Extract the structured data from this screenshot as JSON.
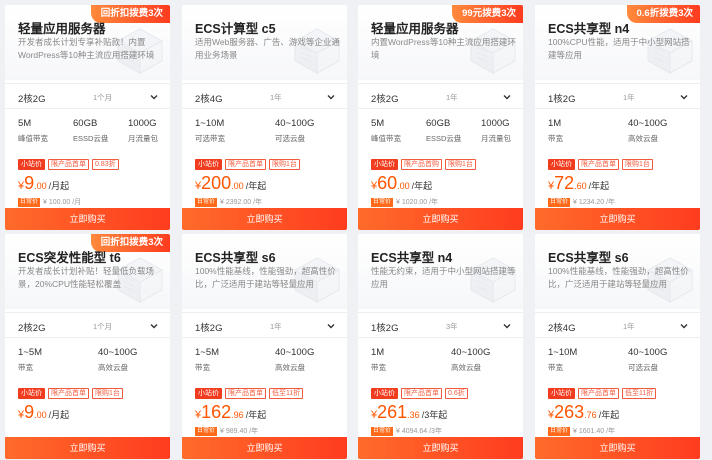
{
  "products": [
    {
      "title": "轻量应用服务器",
      "badge": "回折扣拨费3次",
      "desc": "开发者成长计划专享补贴款！内置WordPress等10种主流应用搭建环境",
      "config": "2核2G",
      "duration": "1个月",
      "specs": [
        {
          "value": "5M",
          "label": "峰值带宽"
        },
        {
          "value": "60GB",
          "label": "ESSD云盘"
        },
        {
          "value": "1000G",
          "label": "月流量包"
        }
      ],
      "tags": [
        "小站价",
        "限产品首单",
        "0.83折"
      ],
      "price_currency": "¥",
      "price_int": "9",
      "price_dec": ".00",
      "price_unit": "/月起",
      "orig_label": "日常价",
      "orig_price": "¥ 100.00 /月",
      "buy": "立即购买"
    },
    {
      "title": "ECS计算型 c5",
      "badge": "",
      "desc": "适用Web服务器、广告、游戏等企业通用业务场景",
      "config": "2核4G",
      "duration": "1年",
      "specs": [
        {
          "value": "1~10M",
          "label": "可选带宽"
        },
        {
          "value": "40~100G",
          "label": "可选云盘"
        }
      ],
      "tags": [
        "小站价",
        "限产品首单",
        "限购1台"
      ],
      "price_currency": "¥",
      "price_int": "200",
      "price_dec": ".00",
      "price_unit": "/年起",
      "orig_label": "日常价",
      "orig_price": "¥ 2392.00 /年",
      "buy": "立即购买"
    },
    {
      "title": "轻量应用服务器",
      "badge": "99元拨费3次",
      "desc": "内置WordPress等10种主流应用搭建环境",
      "config": "2核2G",
      "duration": "1年",
      "specs": [
        {
          "value": "5M",
          "label": "峰值带宽"
        },
        {
          "value": "60GB",
          "label": "ESSD云盘"
        },
        {
          "value": "1000G",
          "label": "月流量包"
        }
      ],
      "tags": [
        "小站价",
        "限产品首购",
        "限购1台"
      ],
      "price_currency": "¥",
      "price_int": "60",
      "price_dec": ".00",
      "price_unit": "/年起",
      "orig_label": "日常价",
      "orig_price": "¥ 1020.00 /年",
      "buy": "立即购买"
    },
    {
      "title": "ECS共享型 n4",
      "badge": "0.6折拨费3次",
      "desc": "100%CPU性能，适用于中小型网站搭建等应用",
      "config": "1核2G",
      "duration": "1年",
      "specs": [
        {
          "value": "1M",
          "label": "带宽"
        },
        {
          "value": "40~100G",
          "label": "高效云盘"
        }
      ],
      "tags": [
        "小站价",
        "限产品首单",
        "限购1台"
      ],
      "price_currency": "¥",
      "price_int": "72",
      "price_dec": ".60",
      "price_unit": "/年起",
      "orig_label": "日常价",
      "orig_price": "¥ 1234.20 /年",
      "buy": "立即购买"
    },
    {
      "title": "ECS突发性能型 t6",
      "badge": "回折扣拨费3次",
      "desc": "开发者成长计划补贴！轻量低负载场景，20%CPU性能轻松覆盖",
      "config": "2核2G",
      "duration": "1个月",
      "specs": [
        {
          "value": "1~5M",
          "label": "带宽"
        },
        {
          "value": "40~100G",
          "label": "高效云盘"
        }
      ],
      "tags": [
        "小站价",
        "限产品首单",
        "限购1台"
      ],
      "price_currency": "¥",
      "price_int": "9",
      "price_dec": ".00",
      "price_unit": "/月起",
      "orig_label": "",
      "orig_price": "",
      "buy": "立即购买"
    },
    {
      "title": "ECS共享型 s6",
      "badge": "",
      "desc": "100%性能基线，性能强劲，超高性价比，广泛适用于建站等轻量应用",
      "config": "1核2G",
      "duration": "1年",
      "specs": [
        {
          "value": "1~5M",
          "label": "带宽"
        },
        {
          "value": "40~100G",
          "label": "高效云盘"
        }
      ],
      "tags": [
        "小站价",
        "限产品首单",
        "低至11折"
      ],
      "price_currency": "¥",
      "price_int": "162",
      "price_dec": ".96",
      "price_unit": "/年起",
      "orig_label": "日常价",
      "orig_price": "¥ 989.40 /年",
      "buy": "立即购买"
    },
    {
      "title": "ECS共享型 n4",
      "badge": "",
      "desc": "性能无约束，适用于中小型网站搭建等应用",
      "config": "1核2G",
      "duration": "3年",
      "specs": [
        {
          "value": "1M",
          "label": "带宽"
        },
        {
          "value": "40~100G",
          "label": "高效云盘"
        }
      ],
      "tags": [
        "小站价",
        "限产品首单",
        "0.6折"
      ],
      "price_currency": "¥",
      "price_int": "261",
      "price_dec": ".36",
      "price_unit": "/3年起",
      "orig_label": "日常价",
      "orig_price": "¥ 4094.64 /3年",
      "buy": "立即购买"
    },
    {
      "title": "ECS共享型 s6",
      "badge": "",
      "desc": "100%性能基线，性能强劲，超高性价比，广泛适用于建站等轻量应用",
      "config": "2核4G",
      "duration": "1年",
      "specs": [
        {
          "value": "1~10M",
          "label": "带宽"
        },
        {
          "value": "40~100G",
          "label": "可选云盘"
        }
      ],
      "tags": [
        "小站价",
        "限产品首单",
        "低至11折"
      ],
      "price_currency": "¥",
      "price_int": "263",
      "price_dec": ".76",
      "price_unit": "/年起",
      "orig_label": "日常价",
      "orig_price": "¥ 1601.40 /年",
      "buy": "立即购买"
    }
  ],
  "icons": {
    "chevron": "chevron-down-icon",
    "decoration": "server-box-icon"
  }
}
